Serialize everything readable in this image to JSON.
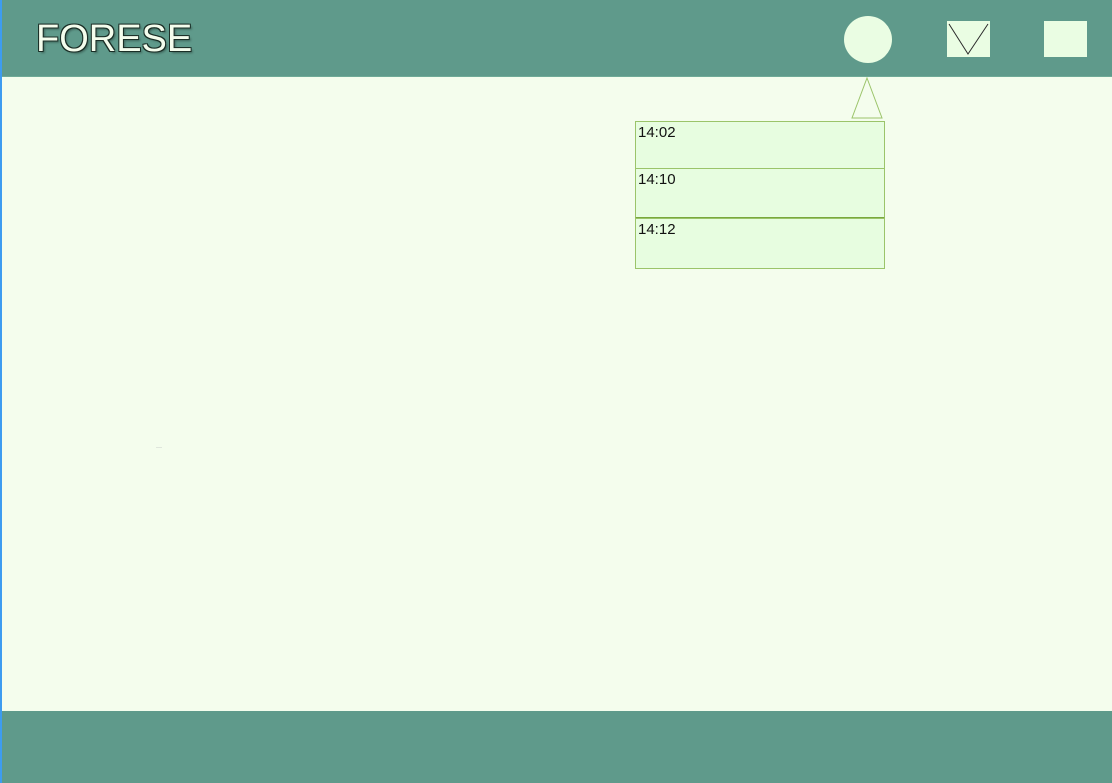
{
  "app": {
    "title": "FORESE"
  },
  "header": {
    "icons": [
      "user-avatar-icon",
      "mail-icon",
      "menu-icon"
    ]
  },
  "notifications": {
    "items": [
      {
        "time": "14:02"
      },
      {
        "time": "14:10"
      },
      {
        "time": "14:12"
      }
    ]
  },
  "colors": {
    "header_bg": "#5f9a8b",
    "page_bg": "#f4fded",
    "icon_bg": "#eafde3",
    "notification_bg": "#e7fde0",
    "notification_border": "#9bc46a"
  }
}
